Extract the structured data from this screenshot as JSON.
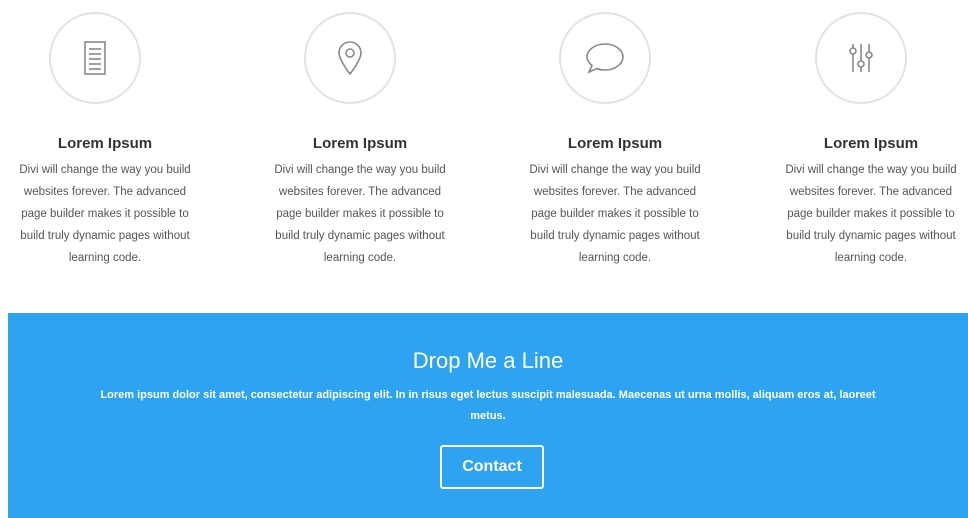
{
  "features": [
    {
      "icon": "document-icon",
      "title": "Lorem Ipsum",
      "text": [
        "Divi will change the way you build",
        "websites forever. The advanced",
        "page builder makes it possible to",
        "build truly dynamic pages without",
        "learning code."
      ]
    },
    {
      "icon": "map-pin-icon",
      "title": "Lorem Ipsum",
      "text": [
        "Divi will change the way you build",
        "websites forever. The advanced",
        "page builder makes it possible to",
        "build truly dynamic pages without",
        "learning code."
      ]
    },
    {
      "icon": "speech-bubble-icon",
      "title": "Lorem Ipsum",
      "text": [
        "Divi will change the way you build",
        "websites forever. The advanced",
        "page builder makes it possible to",
        "build truly dynamic pages without",
        "learning code."
      ]
    },
    {
      "icon": "sliders-icon",
      "title": "Lorem Ipsum",
      "text": [
        "Divi will change the way you build",
        "websites forever. The advanced",
        "page builder makes it possible to",
        "build truly dynamic pages without",
        "learning code."
      ]
    }
  ],
  "cta": {
    "title": "Drop Me a Line",
    "text": [
      "Lorem ipsum dolor sit amet, consectetur adipiscing elit. In in risus eget lectus suscipit malesuada. Maecenas ut urna mollis, aliquam eros at, laoreet",
      "metus."
    ],
    "button_label": "Contact"
  },
  "colors": {
    "accent": "#2ea3f2",
    "icon_stroke": "#888888",
    "circle_border": "#e3e3e3"
  }
}
